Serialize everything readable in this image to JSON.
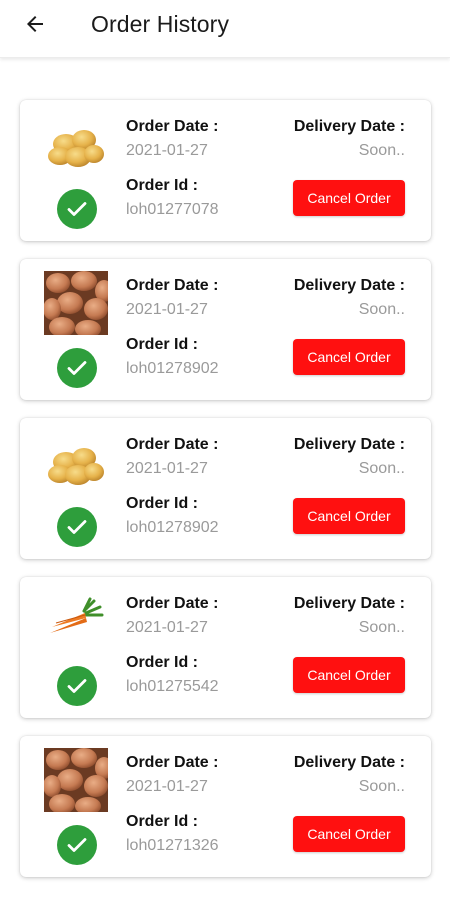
{
  "header": {
    "back_icon": "arrow-left-icon",
    "title": "Order History"
  },
  "labels": {
    "order_date": "Order Date :",
    "order_id": "Order Id :",
    "delivery_date": "Delivery Date :",
    "cancel": "Cancel Order"
  },
  "colors": {
    "cancel_button": "#ff1010",
    "status_check": "#2e9e3c"
  },
  "orders": [
    {
      "product_icon": "potatoes-image",
      "status_icon": "check-circle-icon",
      "order_date": "2021-01-27",
      "order_id": "loh01277078",
      "delivery_date": "Soon.."
    },
    {
      "product_icon": "eggs-image",
      "status_icon": "check-circle-icon",
      "order_date": "2021-01-27",
      "order_id": "loh01278902",
      "delivery_date": "Soon.."
    },
    {
      "product_icon": "potatoes-image",
      "status_icon": "check-circle-icon",
      "order_date": "2021-01-27",
      "order_id": "loh01278902",
      "delivery_date": "Soon.."
    },
    {
      "product_icon": "carrots-image",
      "status_icon": "check-circle-icon",
      "order_date": "2021-01-27",
      "order_id": "loh01275542",
      "delivery_date": "Soon.."
    },
    {
      "product_icon": "eggs-image",
      "status_icon": "check-circle-icon",
      "order_date": "2021-01-27",
      "order_id": "loh01271326",
      "delivery_date": "Soon.."
    }
  ]
}
